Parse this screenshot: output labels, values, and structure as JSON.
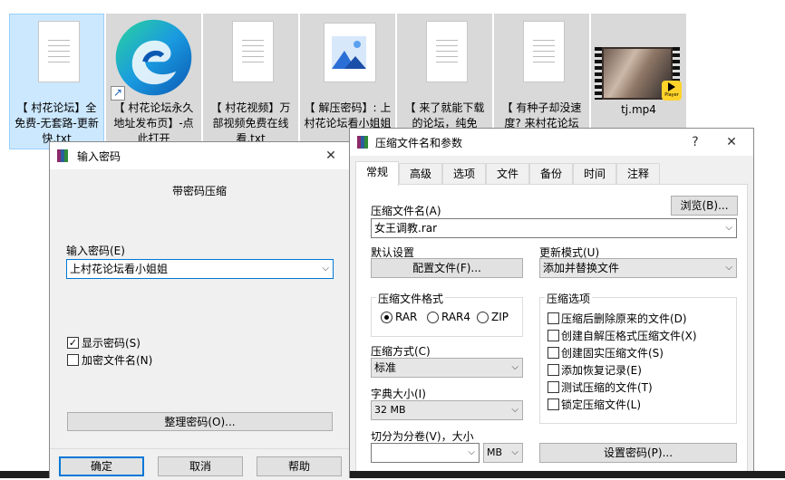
{
  "desktop": {
    "files": [
      {
        "label": "【 村花论坛】全免费-无套路-更新快.txt",
        "selected": true
      },
      {
        "label": "【 村花论坛永久地址发布页】-点此打开"
      },
      {
        "label": "【 村花视频】万部视频免费在线看.txt"
      },
      {
        "label": "【 解压密码】: 上村花论坛看小姐姐"
      },
      {
        "label": "【 来了就能下载的论坛，纯免"
      },
      {
        "label": "【 有种子却没速度? 来村花论坛"
      },
      {
        "label": "tj.mp4"
      }
    ],
    "player_badge": "Player"
  },
  "password_dialog": {
    "title": "输入密码",
    "close": "✕",
    "heading": "带密码压缩",
    "password_label": "输入密码(E)",
    "password_value": "上村花论坛看小姐姐",
    "show_password": {
      "label": "显示密码(S)",
      "checked": true
    },
    "encrypt_names": {
      "label": "加密文件名(N)",
      "checked": false
    },
    "organize_button": "整理密码(O)...",
    "ok_button": "确定",
    "cancel_button": "取消",
    "help_button": "帮助"
  },
  "archive_dialog": {
    "title": "压缩文件名和参数",
    "help": "?",
    "close": "✕",
    "tabs": [
      "常规",
      "高级",
      "选项",
      "文件",
      "备份",
      "时间",
      "注释"
    ],
    "active_tab": 0,
    "archive_name_label": "压缩文件名(A)",
    "browse_button": "浏览(B)...",
    "archive_name_value": "女王调教.rar",
    "default_settings_label": "默认设置",
    "profiles_button": "配置文件(F)...",
    "update_mode_label": "更新模式(U)",
    "update_mode_value": "添加并替换文件",
    "format_group_label": "压缩文件格式",
    "formats": [
      {
        "label": "RAR",
        "selected": true
      },
      {
        "label": "RAR4",
        "selected": false
      },
      {
        "label": "ZIP",
        "selected": false
      }
    ],
    "options_group_label": "压缩选项",
    "options": [
      {
        "label": "压缩后删除原来的文件(D)",
        "checked": false
      },
      {
        "label": "创建自解压格式压缩文件(X)",
        "checked": false
      },
      {
        "label": "创建固实压缩文件(S)",
        "checked": false
      },
      {
        "label": "添加恢复记录(E)",
        "checked": false
      },
      {
        "label": "测试压缩的文件(T)",
        "checked": false
      },
      {
        "label": "锁定压缩文件(L)",
        "checked": false
      }
    ],
    "method_label": "压缩方式(C)",
    "method_value": "标准",
    "dict_label": "字典大小(I)",
    "dict_value": "32 MB",
    "split_label": "切分为分卷(V)，大小",
    "split_value": "",
    "split_unit": "MB",
    "set_password_button": "设置密码(P)..."
  },
  "colors": {
    "accent": "#0078d7",
    "selected_tile": "#cce8ff",
    "dialog_bg": "#f0f0f0"
  }
}
